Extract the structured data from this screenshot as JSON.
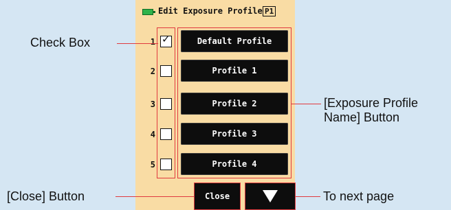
{
  "screen": {
    "title": "Edit Exposure Profile",
    "page_badge": "P1",
    "rows": [
      {
        "num": "1",
        "checked": true,
        "label": "Default Profile"
      },
      {
        "num": "2",
        "checked": false,
        "label": "Profile 1"
      },
      {
        "num": "3",
        "checked": false,
        "label": "Profile 2"
      },
      {
        "num": "4",
        "checked": false,
        "label": "Profile 3"
      },
      {
        "num": "5",
        "checked": false,
        "label": "Profile 4"
      }
    ],
    "check_glyph": "✓",
    "close_label": "Close",
    "next_icon": "down-triangle-icon"
  },
  "callouts": {
    "check_box": "Check Box",
    "profile_name_line1": "[Exposure Profile",
    "profile_name_line2": "Name] Button",
    "close_button": "[Close] Button",
    "next_page": "To next page"
  },
  "colors": {
    "background": "#d5e6f3",
    "screen": "#f9dca4",
    "button": "#0d0d0d",
    "highlight": "#e0393e",
    "battery": "#2fb34a"
  }
}
